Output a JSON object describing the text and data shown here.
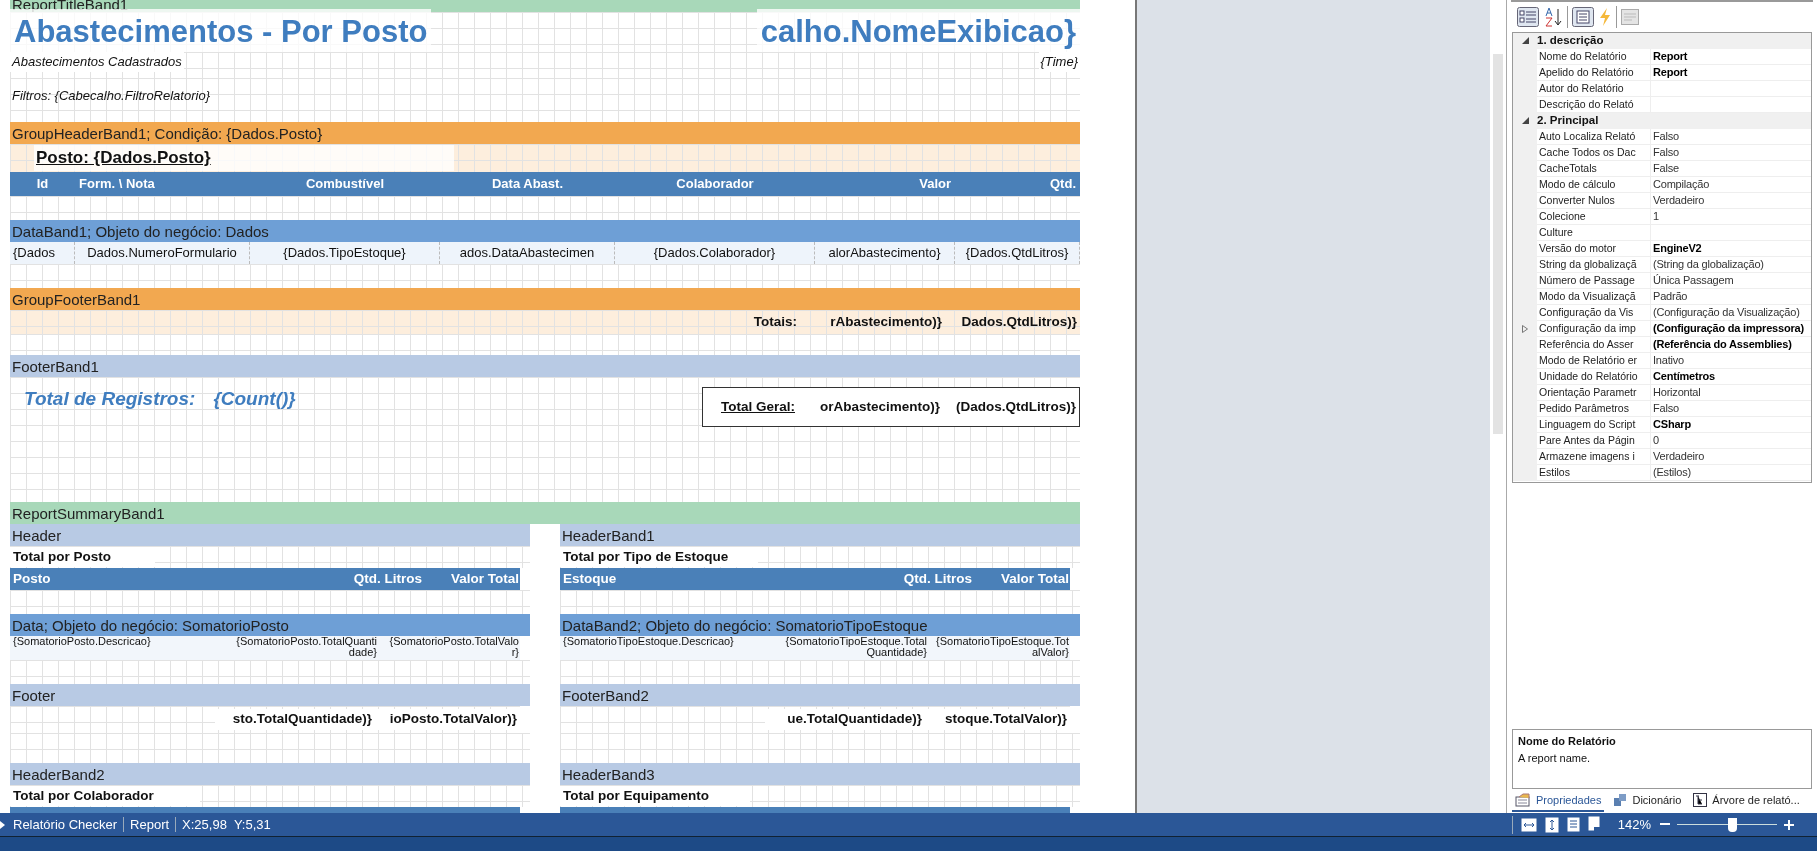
{
  "report": {
    "title_band": {
      "kind": "title",
      "label": "ReportTitleBand1"
    },
    "title": "Abastecimentos - Por Posto",
    "title_right": "calho.NomeExibicao}",
    "subtitle": "Abastecimentos Cadastrados",
    "time": "{Time}",
    "filters": "Filtros: {Cabecalho.FiltroRelatorio}",
    "group_header": {
      "kind": "group",
      "label": "GroupHeaderBand1; Condição: {Dados.Posto}",
      "posto": "Posto:  {Dados.Posto}",
      "columns": [
        "Id",
        "Form. \\ Nota",
        "Combustível",
        "Data Abast.",
        "Colaborador",
        "Valor",
        "Qtd."
      ]
    },
    "data_band": {
      "kind": "data",
      "label": "DataBand1; Objeto do negócio: Dados",
      "cells": [
        "{Dados",
        "Dados.NumeroFormulario",
        "{Dados.TipoEstoque}",
        "ados.DataAbastecimen",
        "{Dados.Colaborador}",
        "alorAbastecimento}",
        "{Dados.QtdLitros}"
      ]
    },
    "group_footer": {
      "kind": "group",
      "label": "GroupFooterBand1",
      "cells": [
        "Totais:",
        "rAbastecimento)}",
        "Dados.QtdLitros)}"
      ]
    },
    "footer": {
      "kind": "light",
      "label": "FooterBand1",
      "count_label": "Total de Registros:",
      "count": "{Count()}",
      "cells": [
        "Total Geral:",
        "orAbastecimento)}",
        "(Dados.QtdLitros)}"
      ]
    },
    "summary": {
      "kind": "title",
      "label": "ReportSummaryBand1",
      "panels": [
        {
          "header": {
            "kind": "light",
            "label": "Header"
          },
          "title": "Total por Posto",
          "columns": [
            "Posto",
            "Qtd. Litros",
            "Valor Total"
          ],
          "data": {
            "kind": "data",
            "label": "Data; Objeto do negócio: SomatorioPosto"
          },
          "cells": [
            "{SomatorioPosto.Descricao}",
            "{SomatorioPosto.TotalQuantidade}",
            "{SomatorioPosto.TotalValor}"
          ],
          "footer": {
            "kind": "light",
            "label": "Footer"
          },
          "totals": [
            "sto.TotalQuantidade)}",
            "ioPosto.TotalValor)}"
          ],
          "next": {
            "kind": "light",
            "label": "HeaderBand2"
          },
          "next_title": "Total por Colaborador"
        },
        {
          "header": {
            "kind": "light",
            "label": "HeaderBand1"
          },
          "title": "Total por Tipo de Estoque",
          "columns": [
            "Estoque",
            "Qtd. Litros",
            "Valor Total"
          ],
          "data": {
            "kind": "data",
            "label": "DataBand2; Objeto do negócio: SomatorioTipoEstoque"
          },
          "cells": [
            "{SomatorioTipoEstoque.Descricao}",
            "{SomatorioTipoEstoque.TotalQuantidade}",
            "{SomatorioTipoEstoque.TotalValor}"
          ],
          "footer": {
            "kind": "light",
            "label": "FooterBand2"
          },
          "totals": [
            "ue.TotalQuantidade)}",
            "stoque.TotalValor)}"
          ],
          "next": {
            "kind": "light",
            "label": "HeaderBand3"
          },
          "next_title": "Total por Equipamento"
        }
      ]
    }
  },
  "properties": {
    "categories": [
      {
        "label": "1. descrição",
        "expanded": true,
        "rows": [
          {
            "name": "Nome do Relatório",
            "value": "Report",
            "modified": true,
            "kind": "plain"
          },
          {
            "name": "Apelido do Relatório",
            "value": "Report",
            "modified": true,
            "kind": "plain"
          },
          {
            "name": "Autor do Relatório",
            "kind": "plain"
          },
          {
            "name": "Descrição do Relató",
            "kind": "plain"
          }
        ]
      },
      {
        "label": "2. Principal",
        "expanded": true,
        "rows": [
          {
            "name": "Auto Localiza Relató",
            "value": "Falso",
            "modified": false,
            "kind": "plain"
          },
          {
            "name": "Cache Todos os Dac",
            "value": "Falso",
            "modified": false,
            "kind": "plain"
          },
          {
            "name": "CacheTotals",
            "value": "False",
            "modified": false,
            "kind": "plain"
          },
          {
            "name": "Modo de cálculo",
            "value": "Compilação",
            "modified": false,
            "kind": "plain"
          },
          {
            "name": "Converter Nulos",
            "value": "Verdadeiro",
            "modified": false,
            "kind": "plain"
          },
          {
            "name": "Colecione",
            "value": "1",
            "modified": false,
            "kind": "plain"
          },
          {
            "name": "Culture",
            "kind": "plain"
          },
          {
            "name": "Versão do motor",
            "value": "EngineV2",
            "modified": true,
            "kind": "plain"
          },
          {
            "name": "String da globalizaçã",
            "value": "(String da globalização)",
            "modified": false,
            "kind": "plain"
          },
          {
            "name": "Número de Passage",
            "value": "Única Passagem",
            "modified": false,
            "kind": "plain"
          },
          {
            "name": "Modo da Visualizaçã",
            "value": "Padrão",
            "modified": false,
            "kind": "plain"
          },
          {
            "name": "Configuração da Vis",
            "value": "(Configuração da Visualização)",
            "modified": false,
            "kind": "plain"
          },
          {
            "name": "Configuração da imp",
            "value": "(Configuração da impressora)",
            "modified": true,
            "kind": "expandable"
          },
          {
            "name": "Referência do Asser",
            "value": "(Referência do Assemblies)",
            "modified": true,
            "kind": "plain"
          },
          {
            "name": "Modo de Relatório er",
            "value": "Inativo",
            "modified": false,
            "kind": "plain"
          },
          {
            "name": "Unidade do Relatório",
            "value": "Centímetros",
            "modified": true,
            "kind": "plain"
          },
          {
            "name": "Orientação Parametr",
            "value": "Horizontal",
            "modified": false,
            "kind": "plain"
          },
          {
            "name": "Pedido Parâmetros",
            "value": "Falso",
            "modified": false,
            "kind": "plain"
          },
          {
            "name": "Linguagem do Script",
            "value": "CSharp",
            "modified": true,
            "kind": "plain"
          },
          {
            "name": "Pare Antes da Págin",
            "value": "0",
            "modified": false,
            "kind": "plain"
          },
          {
            "name": "Armazene imagens i",
            "value": "Verdadeiro",
            "modified": false,
            "kind": "plain"
          },
          {
            "name": "Estilos",
            "value": "(Estilos)",
            "modified": false,
            "kind": "plain"
          }
        ]
      }
    ],
    "description": {
      "title": "Nome do Relatório",
      "text": "A report name."
    },
    "tabs": [
      {
        "label": "Propriedades",
        "selected": true
      },
      {
        "label": "Dicionário",
        "selected": false
      },
      {
        "label": "Árvore de relató...",
        "selected": false
      }
    ]
  },
  "status_bar": {
    "items": [
      "Relatório Checker",
      "Report",
      "X:25,98  Y:5,31"
    ],
    "zoom": "142%",
    "zoom_slider": {
      "level": 0.55
    }
  }
}
